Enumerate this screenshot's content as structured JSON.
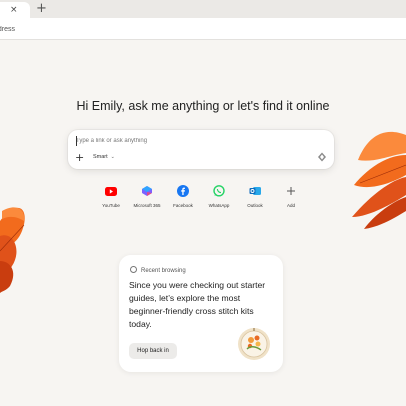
{
  "tabbar": {
    "close_glyph": "×",
    "new_tab_glyph": "+"
  },
  "address": {
    "placeholder": "ddress"
  },
  "main": {
    "heading": "Hi Emily, ask me anything or let's find it online",
    "search": {
      "placeholder": "Type a link or ask anything",
      "plus_glyph": "+",
      "mode_label": "Smart",
      "mode_chevron": "⌄"
    },
    "shortcuts": [
      {
        "label": "YouTube",
        "icon": "youtube-icon",
        "color": "#ff0000"
      },
      {
        "label": "Microsoft 365",
        "icon": "microsoft-365-icon",
        "color": "#7b61ff"
      },
      {
        "label": "Facebook",
        "icon": "facebook-icon",
        "color": "#1877f2"
      },
      {
        "label": "WhatsApp",
        "icon": "whatsapp-icon",
        "color": "#25d366"
      },
      {
        "label": "Outlook",
        "icon": "outlook-icon",
        "color": "#0f6cbd"
      },
      {
        "label": "Add",
        "icon": "plus-icon",
        "color": "#555555"
      }
    ],
    "recent": {
      "header": "Recent browsing",
      "body": "Since you were checking out starter guides, let’s explore the most beginner-friendly cross stitch kits today.",
      "button": "Hop back in"
    }
  },
  "colors": {
    "leaf_orange": "#f26b1d",
    "leaf_dark": "#c93d0f",
    "background": "#f7f5f2"
  }
}
